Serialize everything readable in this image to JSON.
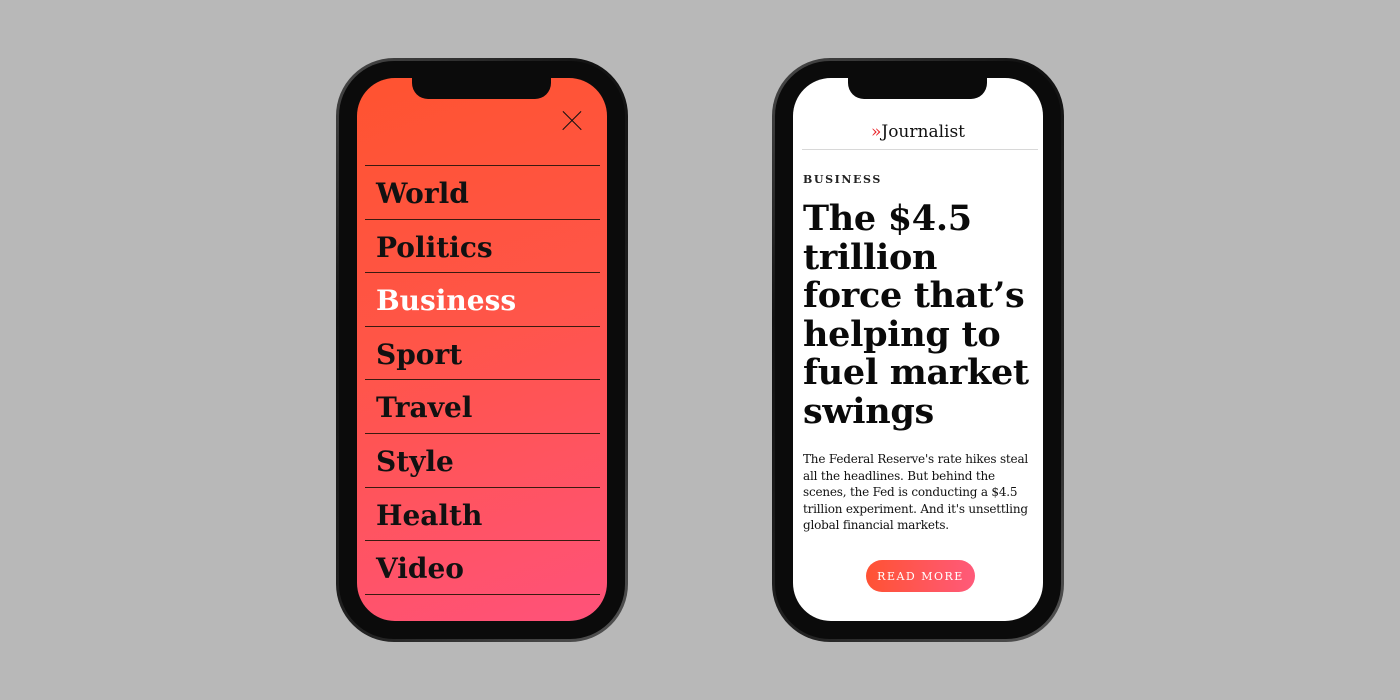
{
  "menu": {
    "items": [
      "World",
      "Politics",
      "Business",
      "Sport",
      "Travel",
      "Style",
      "Health",
      "Video"
    ],
    "active": "Business",
    "close_icon": "close-icon"
  },
  "article": {
    "logo_mark": "»",
    "logo_text": "Journalist",
    "category": "BUSINESS",
    "headline": "The $4.5 trillion force that’s helping to fuel market swings",
    "body": "The Federal Reserve's rate hikes steal all the headlines. But behind the scenes, the Fed is conducting a $4.5 trillion experiment. And it's unsettling global financial markets.",
    "cta": "READ MORE"
  },
  "colors": {
    "accent": "#ff5340",
    "accent_end": "#ff527a",
    "logo_mark": "#e8262b",
    "background": "#b8b8b8"
  }
}
